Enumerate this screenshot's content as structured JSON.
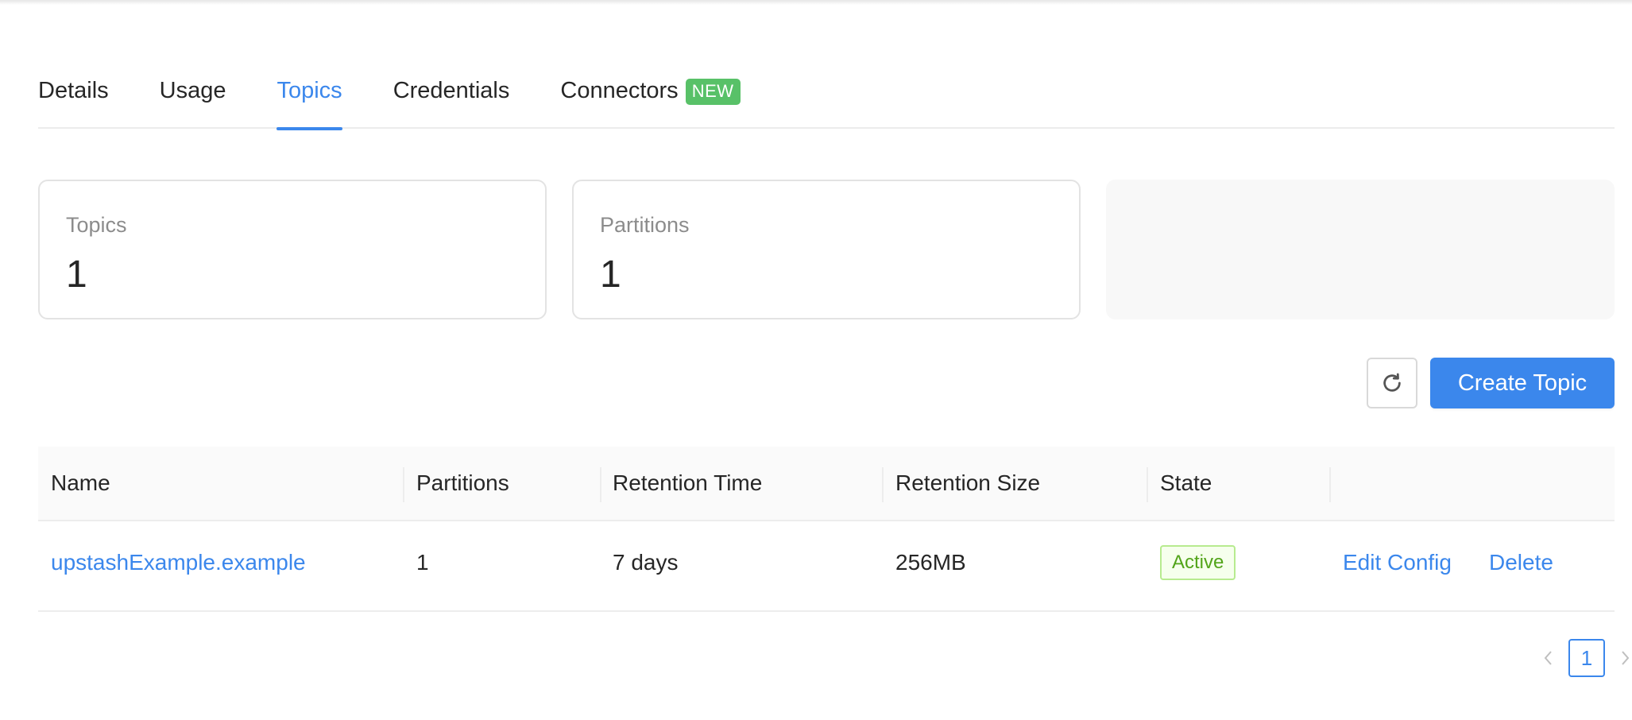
{
  "tabs": [
    {
      "label": "Details"
    },
    {
      "label": "Usage"
    },
    {
      "label": "Topics"
    },
    {
      "label": "Credentials"
    },
    {
      "label": "Connectors",
      "badge": "NEW"
    }
  ],
  "active_tab": "Topics",
  "stats": {
    "topics": {
      "label": "Topics",
      "value": "1"
    },
    "partitions": {
      "label": "Partitions",
      "value": "1"
    }
  },
  "toolbar": {
    "create_label": "Create Topic"
  },
  "table": {
    "columns": [
      "Name",
      "Partitions",
      "Retention Time",
      "Retention Size",
      "State",
      ""
    ],
    "rows": [
      {
        "name": "upstashExample.example",
        "partitions": "1",
        "retention_time": "7 days",
        "retention_size": "256MB",
        "state": "Active",
        "actions": [
          "Edit Config",
          "Delete"
        ]
      }
    ]
  },
  "pagination": {
    "current": "1"
  },
  "colors": {
    "accent": "#3b87ec",
    "new_badge": "#58c168",
    "active_state": "#52a41a"
  },
  "icons": {
    "refresh": "refresh-icon",
    "prev": "chevron-left-icon",
    "next": "chevron-right-icon"
  }
}
